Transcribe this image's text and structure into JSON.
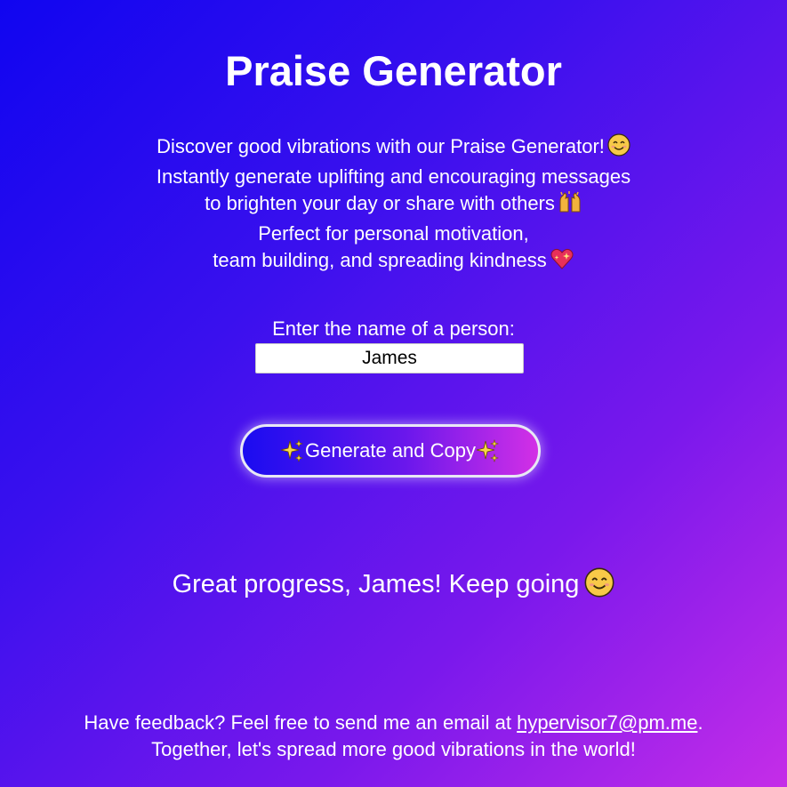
{
  "header": {
    "title": "Praise Generator"
  },
  "intro": {
    "line1": "Discover good vibrations with our Praise Generator!",
    "line1_icon": "smiling-face-icon",
    "line2": "Instantly generate uplifting and encouraging messages",
    "line3": "to brighten your day or share with others",
    "line3_icon": "raising-hands-icon",
    "line4": "Perfect for personal motivation,",
    "line5": "team building, and spreading kindness",
    "line5_icon": "sparkling-heart-icon"
  },
  "form": {
    "label": "Enter the name of a person:",
    "name_value": "James",
    "button_label": "Generate and Copy",
    "button_icons": [
      "sparkles-icon",
      "sparkles-icon"
    ]
  },
  "result": {
    "praise": "Great progress, James! Keep going",
    "praise_icon": "smiling-face-icon"
  },
  "footer": {
    "line1_prefix": "Have feedback? Feel free to send me an email at",
    "email": "hypervisor7@pm.me",
    "line1_suffix": ".",
    "line2": "Together, let's spread more good vibrations in the world!"
  },
  "colors": {
    "background_start": "#1005f0",
    "background_end": "#c52de8",
    "text": "#ffffff",
    "button_border": "#e8e8f5"
  }
}
